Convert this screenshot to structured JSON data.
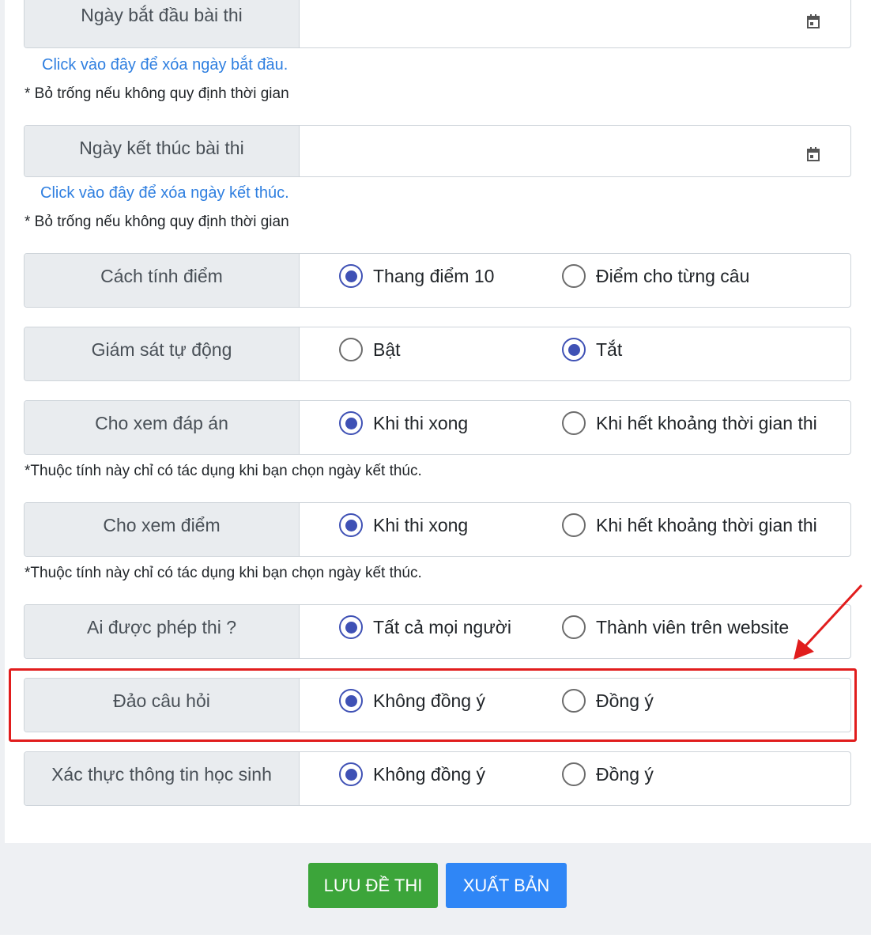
{
  "date_fields": [
    {
      "label": "Ngày bắt đầu bài thi",
      "value": "",
      "clear_link": "Click vào đây để xóa ngày bắt đầu.",
      "hint": "* Bỏ trống nếu không quy định thời gian"
    },
    {
      "label": "Ngày kết thúc bài thi",
      "value": "",
      "clear_link": "Click vào đây để xóa ngày kết thúc.",
      "hint": "* Bỏ trống nếu không quy định thời gian"
    }
  ],
  "options": [
    {
      "label": "Cách tính điểm",
      "choices": [
        "Thang điểm 10",
        "Điểm cho từng câu"
      ],
      "selected": 0
    },
    {
      "label": "Giám sát tự động",
      "choices": [
        "Bật",
        "Tắt"
      ],
      "selected": 1
    },
    {
      "label": "Cho xem đáp án",
      "choices": [
        "Khi thi xong",
        "Khi hết khoảng thời gian thi"
      ],
      "selected": 0,
      "note": "*Thuộc tính này chỉ có tác dụng khi bạn chọn ngày kết thúc."
    },
    {
      "label": "Cho xem điểm",
      "choices": [
        "Khi thi xong",
        "Khi hết khoảng thời gian thi"
      ],
      "selected": 0,
      "note": "*Thuộc tính này chỉ có tác dụng khi bạn chọn ngày kết thúc."
    },
    {
      "label": "Ai được phép thi ?",
      "choices": [
        "Tất cả mọi người",
        "Thành viên trên website"
      ],
      "selected": 0
    },
    {
      "label": "Đảo câu hỏi",
      "choices": [
        "Không đồng ý",
        "Đồng ý"
      ],
      "selected": 0,
      "highlighted": true
    },
    {
      "label": "Xác thực thông tin học sinh",
      "choices": [
        "Không đồng ý",
        "Đồng ý"
      ],
      "selected": 0
    }
  ],
  "buttons": {
    "save": "LƯU ĐỀ THI",
    "publish": "XUẤT BẢN"
  },
  "colors": {
    "radio_selected": "#3f51b5",
    "link": "#2f7fe0",
    "highlight": "#e11d1d",
    "save_button": "#3ca53a",
    "publish_button": "#2f86f6"
  },
  "icons": {
    "date_picker": "calendar-icon",
    "annotation": "red-arrow"
  }
}
